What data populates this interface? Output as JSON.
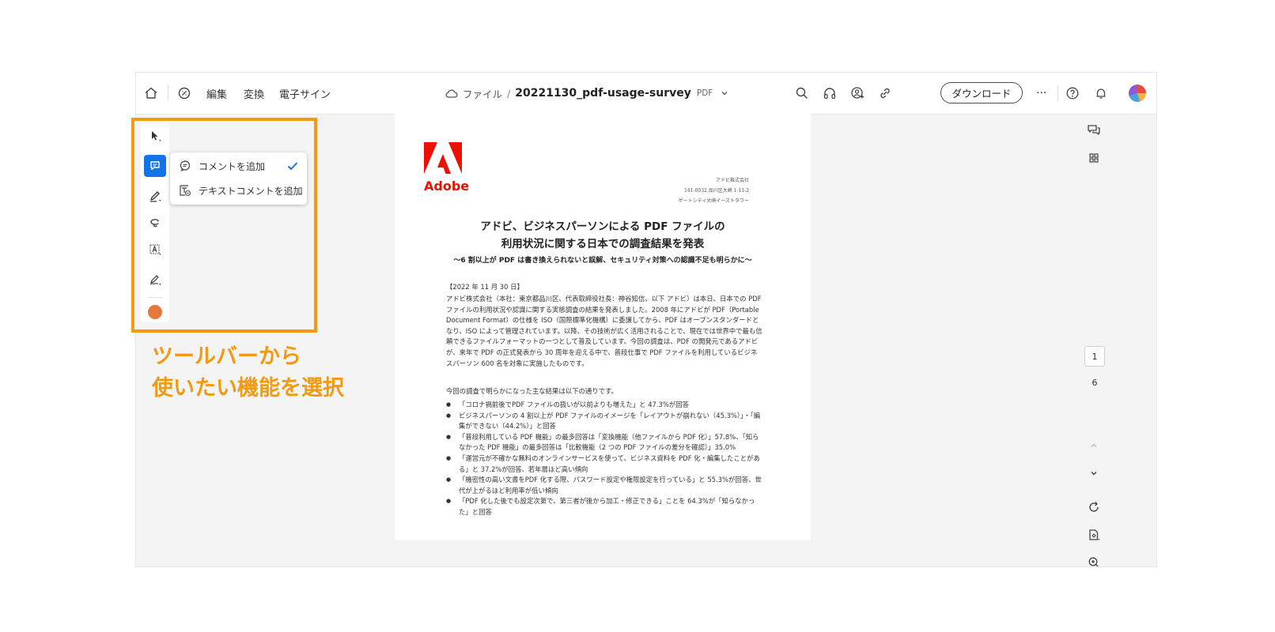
{
  "nav": {
    "edit": "編集",
    "convert": "変換",
    "esign": "電子サイン"
  },
  "breadcrumb": {
    "file": "ファイル",
    "separator": "/",
    "filename": "20221130_pdf-usage-survey",
    "filetype": "PDF"
  },
  "toolbar": {
    "download_label": "ダウンロード",
    "more_label": "···"
  },
  "comment_menu": {
    "items": [
      {
        "label": "コメントを追加",
        "checked": true
      },
      {
        "label": "テキストコメントを追加",
        "checked": false
      }
    ]
  },
  "annotation": {
    "line1": "ツールバーから",
    "line2": "使いたい機能を選択"
  },
  "document": {
    "logo_text": "Adobe",
    "address": [
      "アドビ株式会社",
      "141-0032 品川区大崎 1-11-2",
      "ゲートシティ大崎イーストタワー"
    ],
    "title1": "アドビ、ビジネスパーソンによる PDF ファイルの",
    "title2": "利用状況に関する日本での調査結果を発表",
    "subtitle": "〜6 割以上が PDF は書き換えられないと誤解、セキュリティ対策への認識不足も明らかに〜",
    "date": "【2022 年 11 月 30 日】",
    "paragraph": "アドビ株式会社（本社：東京都品川区、代表取締役社長：神谷知信、以下 アドビ）は本日、日本での PDF ファイルの利用状況や認識に関する実態調査の結果を発表しました。2008 年にアドビが PDF（Portable Document Format）の仕様を ISO（国際標準化機構）に委譲してから、PDF はオープンスタンダードとなり、ISO によって管理されています。以降、その技術が広く活用されることで、現在では世界中で最も信頼できるファイルフォーマットの一つとして普及しています。今回の調査は、PDF の開発元であるアドビが、来年で PDF の正式発表から 30 周年を迎える中で、普段仕事で PDF ファイルを利用しているビジネスパーソン 600 名を対象に実施したものです。",
    "intro": "今回の調査で明らかになった主な結果は以下の通りです。",
    "bullets": [
      "「コロナ禍前後でPDF ファイルの扱いが以前よりも増えた」と 47.3%が回答",
      "ビジネスパーソンの 4 割以上が PDF ファイルのイメージを「レイアウトが崩れない（45.3%）」・「編集ができない（44.2%）」と回答",
      "「普段利用している PDF 機能」の最多回答は「変換機能（他ファイルから PDF 化）」57.8%、「知らなかった PDF 機能」の最多回答は「比較機能（2 つの PDF ファイルの差分を確認）」35.0%",
      "「運営元が不確かな無料のオンラインサービスを使って、ビジネス資料を PDF 化・編集したことがある」と 37.2%が回答、若年層ほど高い傾向",
      "「機密性の高い文書をPDF 化する際、パスワード設定や権限設定を行っている」と 55.3%が回答、世代が上がるほど利用率が低い傾向",
      "「PDF 化した後でも設定次第で、第三者が後から加工・修正できる」ことを 64.3%が「知らなかった」と回答"
    ]
  },
  "pager": {
    "current": "1",
    "total": "6"
  },
  "colors": {
    "accent": "#1473e6",
    "annotation_orange": "#f39a13",
    "adobe_red": "#eb1000",
    "selected_color": "#e7773d"
  }
}
